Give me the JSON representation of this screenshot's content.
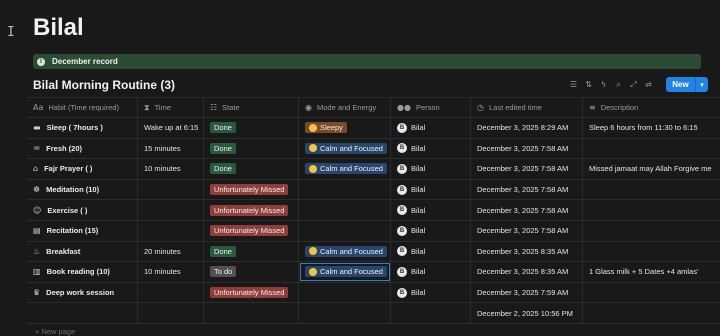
{
  "page": {
    "title": "Bilal"
  },
  "callout": {
    "text": "December record",
    "icon": "info-icon"
  },
  "database": {
    "title": "Bilal Morning Routine (3)",
    "new_button": "New",
    "toolbar_icons": [
      "filter-icon",
      "sort-icon",
      "automation-icon",
      "search-icon",
      "expand-icon",
      "settings-icon"
    ]
  },
  "columns": [
    {
      "label": "Habit (Time required)",
      "icon": "text-icon"
    },
    {
      "label": "Time",
      "icon": "hourglass-icon"
    },
    {
      "label": "State",
      "icon": "list-icon"
    },
    {
      "label": "Mode and Energy",
      "icon": "target-icon"
    },
    {
      "label": "Person",
      "icon": "people-icon"
    },
    {
      "label": "Last edited time",
      "icon": "clock-icon"
    },
    {
      "label": "Description",
      "icon": "lines-icon"
    }
  ],
  "rows": [
    {
      "icon": "bed-icon",
      "habit": "Sleep ( 7hours )",
      "time": "Wake up at 6:15",
      "state": "Done",
      "state_kind": "done",
      "mode": "Sleepy",
      "mode_kind": "sleepy",
      "person": "Bilal",
      "edited": "December 3, 2025 8:29 AM",
      "description": "Sleep 6 hours from 11:30 to 6:15"
    },
    {
      "icon": "shower-icon",
      "habit": "Fresh (20)",
      "time": "15 minutes",
      "state": "Done",
      "state_kind": "done",
      "mode": "Calm and Focused",
      "mode_kind": "calm",
      "person": "Bilal",
      "edited": "December 3, 2025 7:58 AM",
      "description": ""
    },
    {
      "icon": "mosque-icon",
      "habit": "Fajr Prayer ( )",
      "time": "10 minutes",
      "state": "Done",
      "state_kind": "done",
      "mode": "Calm and Focused",
      "mode_kind": "calm",
      "person": "Bilal",
      "edited": "December 3, 2025 7:58 AM",
      "description": "Missed jamaat may Allah Forgive me"
    },
    {
      "icon": "meditation-icon",
      "habit": "Meditation (10)",
      "time": "",
      "state": "Unfortunately Missed",
      "state_kind": "missed",
      "mode": "",
      "mode_kind": "",
      "person": "Bilal",
      "edited": "December 3, 2025 7:58 AM",
      "description": ""
    },
    {
      "icon": "exercise-icon",
      "habit": "Exercise ( )",
      "time": "",
      "state": "Unfortunately Missed",
      "state_kind": "missed",
      "mode": "",
      "mode_kind": "",
      "person": "Bilal",
      "edited": "December 3, 2025 7:58 AM",
      "description": ""
    },
    {
      "icon": "book-icon",
      "habit": "Recitation (15)",
      "time": "",
      "state": "Unfortunately Missed",
      "state_kind": "missed",
      "mode": "",
      "mode_kind": "",
      "person": "Bilal",
      "edited": "December 3, 2025 7:58 AM",
      "description": ""
    },
    {
      "icon": "food-icon",
      "habit": "Breakfast",
      "time": "20 minutes",
      "state": "Done",
      "state_kind": "done",
      "mode": "Calm and Focused",
      "mode_kind": "calm",
      "person": "Bilal",
      "edited": "December 3, 2025 8:35 AM",
      "description": ""
    },
    {
      "icon": "book-open-icon",
      "habit": "Book reading (10)",
      "time": "10 minutes",
      "state": "To do",
      "state_kind": "todo",
      "mode": "Calm and Focused",
      "mode_kind": "calm",
      "person": "Bilal",
      "edited": "December 3, 2025 8:35 AM",
      "description": "1 Glass milk + 5 Dates +4 amlas'"
    },
    {
      "icon": "crown-icon",
      "habit": "Deep work session",
      "time": "",
      "state": "Unfortunately Missed",
      "state_kind": "missed",
      "mode": "",
      "mode_kind": "",
      "person": "Bilal",
      "edited": "December 3, 2025 7:59 AM",
      "description": ""
    },
    {
      "icon": "",
      "habit": "",
      "time": "",
      "state": "",
      "state_kind": "",
      "mode": "",
      "mode_kind": "",
      "person": "",
      "edited": "December 2, 2025 10:56 PM",
      "description": ""
    }
  ],
  "footer": {
    "new_page": "+ New page"
  }
}
